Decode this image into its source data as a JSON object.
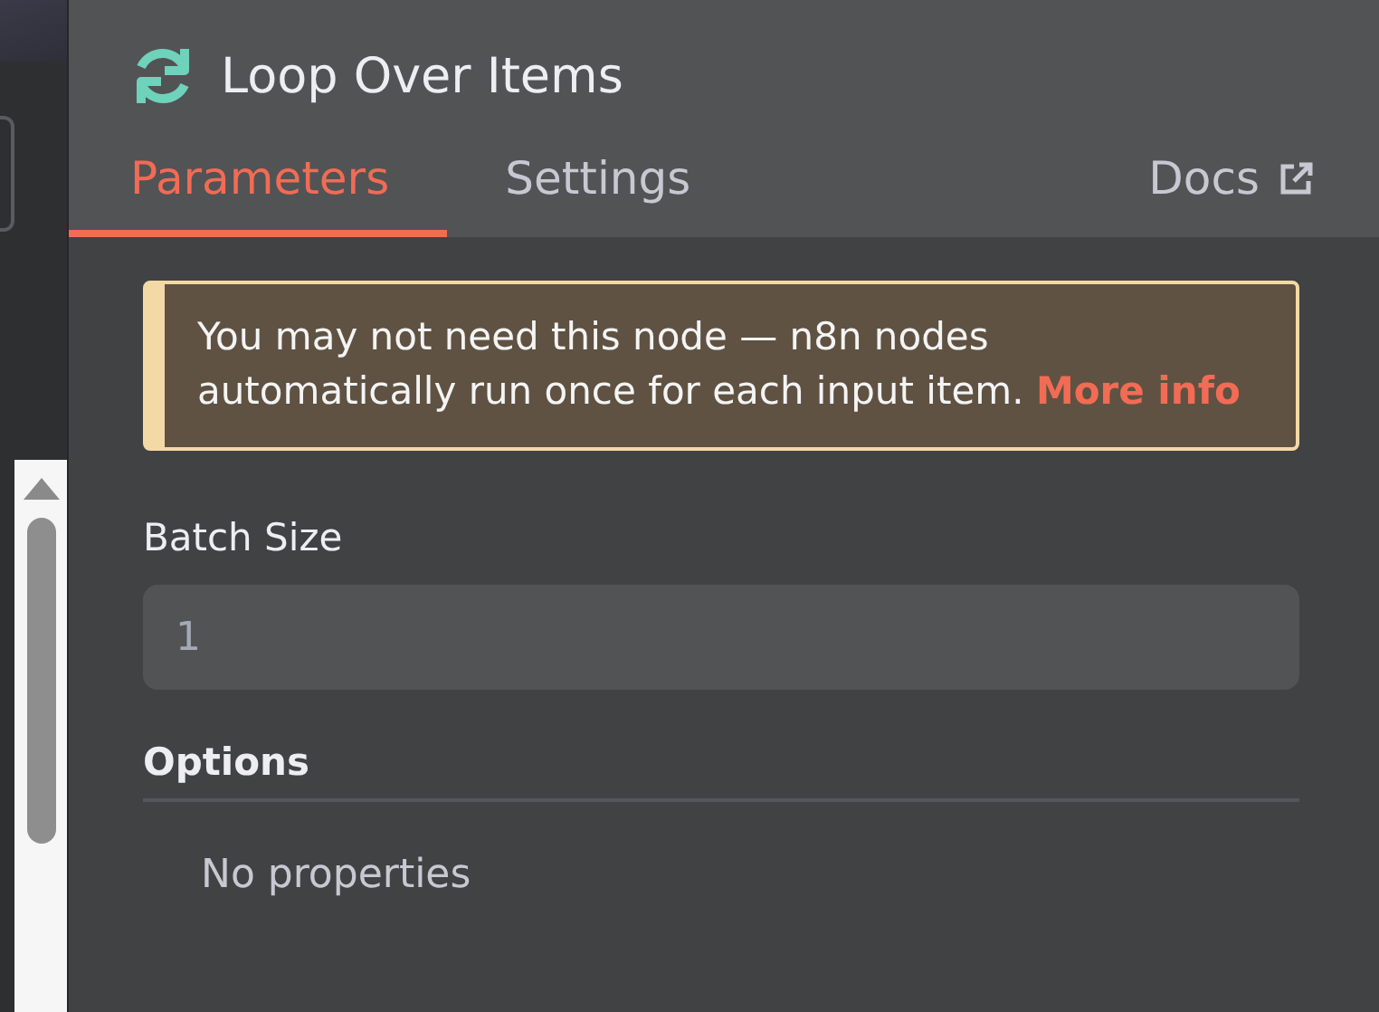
{
  "node": {
    "title": "Loop Over Items"
  },
  "tabs": [
    {
      "label": "Parameters",
      "selected": true
    },
    {
      "label": "Settings",
      "selected": false
    }
  ],
  "docs_link": {
    "label": "Docs"
  },
  "notice": {
    "text": "You may not need this node — n8n nodes automatically run once for each input item.",
    "link": "More info"
  },
  "batch_size": {
    "label": "Batch Size",
    "value": "1"
  },
  "options": {
    "heading": "Options",
    "empty_text": "No properties"
  }
}
